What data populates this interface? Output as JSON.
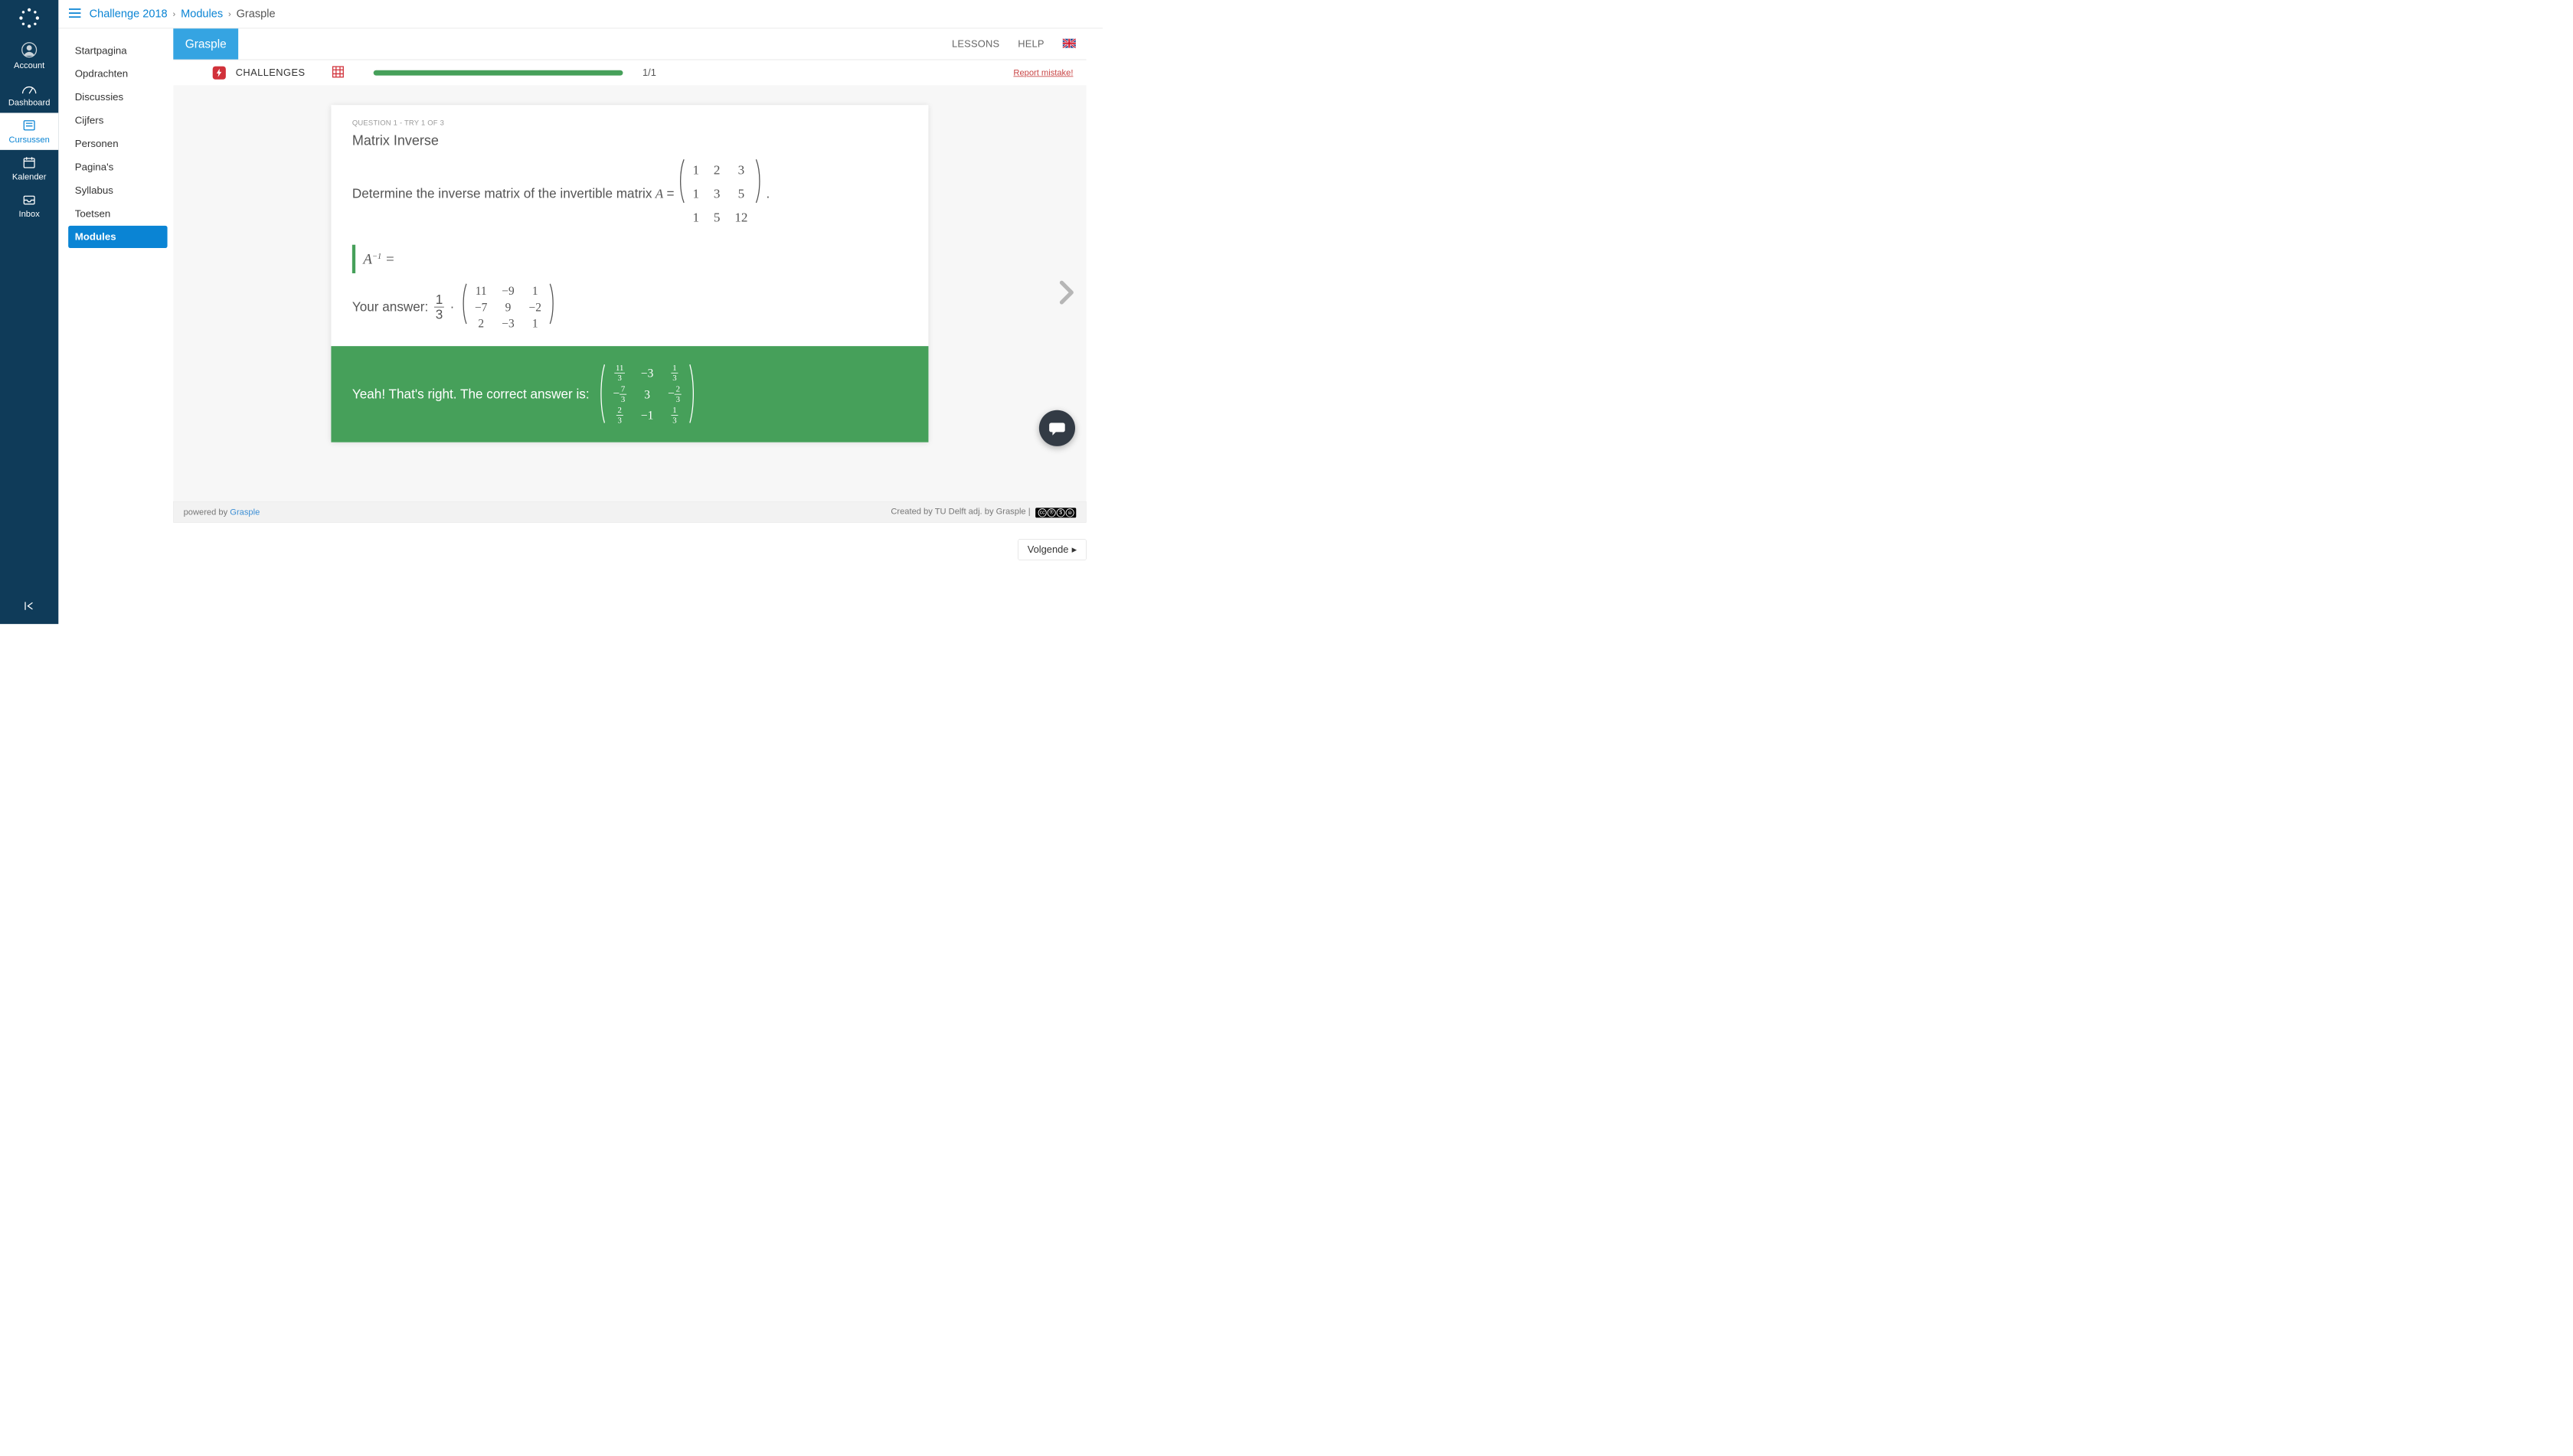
{
  "global_nav": {
    "items": [
      {
        "id": "account",
        "label": "Account"
      },
      {
        "id": "dashboard",
        "label": "Dashboard"
      },
      {
        "id": "courses",
        "label": "Cursussen"
      },
      {
        "id": "calendar",
        "label": "Kalender"
      },
      {
        "id": "inbox",
        "label": "Inbox"
      }
    ],
    "active_id": "courses"
  },
  "breadcrumb": {
    "course": "Challenge 2018",
    "section": "Modules",
    "current": "Grasple"
  },
  "course_nav": {
    "items": [
      "Startpagina",
      "Opdrachten",
      "Discussies",
      "Cijfers",
      "Personen",
      "Pagina's",
      "Syllabus",
      "Toetsen",
      "Modules"
    ],
    "active": "Modules"
  },
  "grasple": {
    "tab_label": "Grasple",
    "lessons_label": "LESSONS",
    "help_label": "HELP",
    "challenges_label": "CHALLENGES",
    "progress_text": "1/1",
    "progress_percent": 100,
    "report_mistake": "Report mistake!"
  },
  "question": {
    "meta": "QUESTION 1 - TRY 1 OF 3",
    "title": "Matrix Inverse",
    "prompt_prefix": "Determine the inverse matrix of the invertible matrix ",
    "var_symbol": "A",
    "equals": " = ",
    "period": " .",
    "matrix_A": [
      [
        "1",
        "2",
        "3"
      ],
      [
        "1",
        "3",
        "5"
      ],
      [
        "1",
        "5",
        "12"
      ]
    ],
    "answer_lhs": "A",
    "answer_exp": "−1",
    "answer_eq": " = ",
    "your_answer_label": "Your answer: ",
    "your_answer_scalar_num": "1",
    "your_answer_scalar_den": "3",
    "your_answer_matrix": [
      [
        "11",
        "−9",
        "1"
      ],
      [
        "−7",
        "9",
        "−2"
      ],
      [
        "2",
        "−3",
        "1"
      ]
    ],
    "feedback_text": "Yeah! That's right. The correct answer is: ",
    "correct_matrix": [
      [
        {
          "num": "11",
          "den": "3"
        },
        "−3",
        {
          "num": "1",
          "den": "3"
        }
      ],
      [
        {
          "neg": true,
          "num": "7",
          "den": "3"
        },
        "3",
        {
          "neg": true,
          "num": "2",
          "den": "3"
        }
      ],
      [
        {
          "num": "2",
          "den": "3"
        },
        "−1",
        {
          "num": "1",
          "den": "3"
        }
      ]
    ]
  },
  "footer": {
    "powered_prefix": "powered by ",
    "powered_link": "Grasple",
    "created_by": "Created by TU Delft adj. by Grasple | "
  },
  "page": {
    "next_label": "Volgende"
  }
}
